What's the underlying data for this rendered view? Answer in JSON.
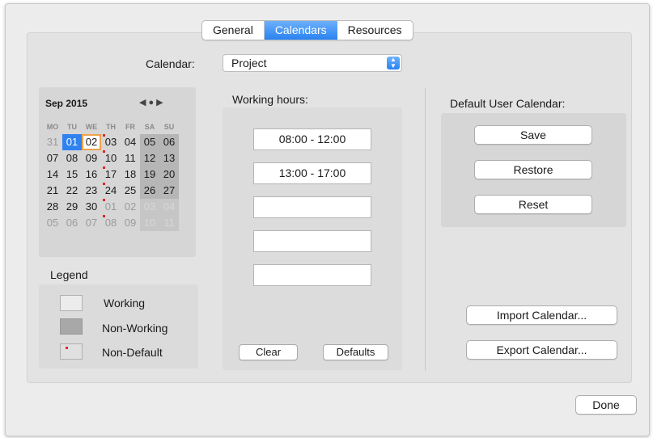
{
  "tabs": [
    {
      "label": "General",
      "active": false
    },
    {
      "label": "Calendars",
      "active": true
    },
    {
      "label": "Resources",
      "active": false
    }
  ],
  "calendar_select": {
    "label": "Calendar:",
    "value": "Project"
  },
  "mini_calendar": {
    "month_label": "Sep 2015",
    "nav_icons": [
      "prev-arrow",
      "today-dot",
      "next-arrow"
    ],
    "weekdays": [
      "MO",
      "TU",
      "WE",
      "TH",
      "FR",
      "SA",
      "SU"
    ],
    "weeks": [
      [
        "31",
        "01",
        "02",
        "03",
        "04",
        "05",
        "06"
      ],
      [
        "07",
        "08",
        "09",
        "10",
        "11",
        "12",
        "13"
      ],
      [
        "14",
        "15",
        "16",
        "17",
        "18",
        "19",
        "20"
      ],
      [
        "21",
        "22",
        "23",
        "24",
        "25",
        "26",
        "27"
      ],
      [
        "28",
        "29",
        "30",
        "01",
        "02",
        "03",
        "04"
      ],
      [
        "05",
        "06",
        "07",
        "08",
        "09",
        "10",
        "11"
      ]
    ],
    "today": "01",
    "selected": "02"
  },
  "legend": {
    "title": "Legend",
    "items": [
      "Working",
      "Non-Working",
      "Non-Default"
    ]
  },
  "working_hours": {
    "title": "Working hours:",
    "slots": [
      "08:00 - 12:00",
      "13:00 - 17:00",
      "",
      "",
      ""
    ],
    "clear_label": "Clear",
    "defaults_label": "Defaults"
  },
  "default_user_calendar": {
    "title": "Default User Calendar:",
    "save_label": "Save",
    "restore_label": "Restore",
    "reset_label": "Reset"
  },
  "import_label": "Import Calendar...",
  "export_label": "Export Calendar...",
  "done_label": "Done",
  "colors": {
    "accent": "#2a82f2",
    "non_default_mark": "#e0262a",
    "selection_outline": "#f0a24a"
  }
}
